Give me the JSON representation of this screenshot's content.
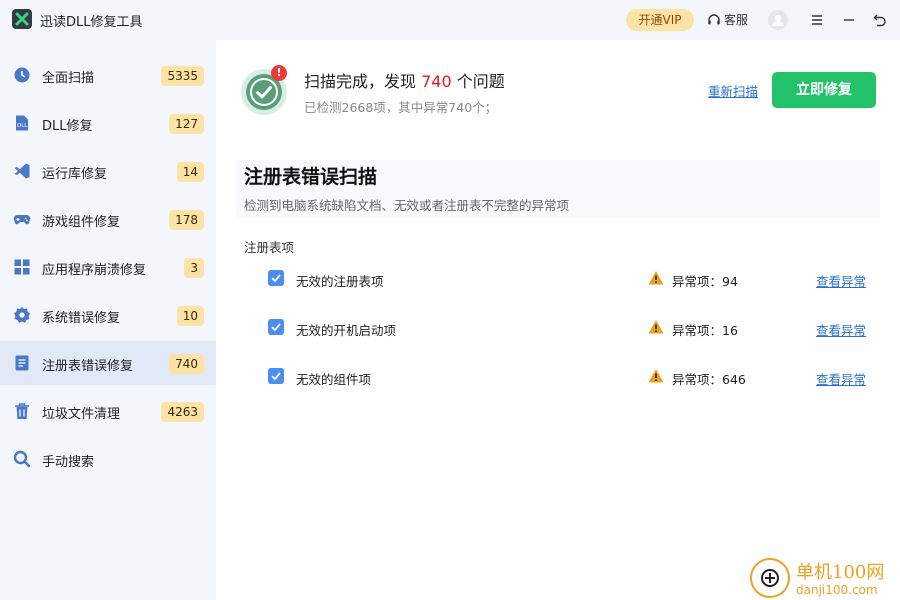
{
  "app": {
    "title": "迅读DLL修复工具"
  },
  "titlebar": {
    "vip_label": "开通VIP",
    "service_label": "客服",
    "icons": [
      "headset-icon",
      "avatar-icon",
      "menu-icon",
      "minimize-icon",
      "back-icon"
    ]
  },
  "sidebar": {
    "items": [
      {
        "label": "全面扫描",
        "badge": "5335",
        "icon": "clock-scan-icon"
      },
      {
        "label": "DLL修复",
        "badge": "127",
        "icon": "dll-icon"
      },
      {
        "label": "运行库修复",
        "badge": "14",
        "icon": "runtime-icon"
      },
      {
        "label": "游戏组件修复",
        "badge": "178",
        "icon": "gamepad-icon"
      },
      {
        "label": "应用程序崩溃修复",
        "badge": "3",
        "icon": "apps-grid-icon"
      },
      {
        "label": "系统错误修复",
        "badge": "10",
        "icon": "gear-icon"
      },
      {
        "label": "注册表错误修复",
        "badge": "740",
        "icon": "registry-icon"
      },
      {
        "label": "垃圾文件清理",
        "badge": "4263",
        "icon": "trash-icon"
      },
      {
        "label": "手动搜索",
        "badge": "",
        "icon": "search-icon"
      }
    ],
    "active_index": 6
  },
  "summary": {
    "title_prefix": "扫描完成，发现",
    "issue_count": "740",
    "title_suffix": "个问题",
    "subtitle": "已检测2668项，其中异常740个；",
    "rescan_label": "重新扫描",
    "fix_label": "立即修复"
  },
  "panel": {
    "title": "注册表错误扫描",
    "description": "检测到电脑系统缺陷文档、无效或者注册表不完整的异常项"
  },
  "section": {
    "label": "注册表项"
  },
  "rows": [
    {
      "label": "无效的注册表项",
      "count": "异常项：94",
      "link": "查看异常",
      "checked": true
    },
    {
      "label": "无效的开机启动项",
      "count": "异常项：16",
      "link": "查看异常",
      "checked": true
    },
    {
      "label": "无效的组件项",
      "count": "异常项：646",
      "link": "查看异常",
      "checked": true
    }
  ],
  "watermark": {
    "line1": "单机100网",
    "line2": "danji100.com"
  },
  "colors": {
    "accent_green": "#22c36b",
    "issue_red": "#e21b1b",
    "link_blue": "#2a6fd6",
    "badge_bg": "#fde2a8"
  }
}
